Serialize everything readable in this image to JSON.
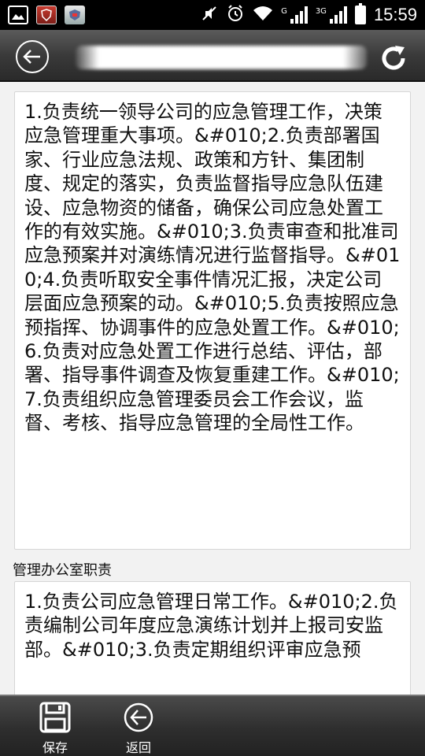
{
  "statusbar": {
    "network_g": "G",
    "network_3g": "3G",
    "time": "15:59"
  },
  "card1": {
    "text": "1.负责统一领导公司的应急管理工作，决策应急管理重大事项。&#010;2.负责部署国家、行业应急法规、政策和方针、集团制度、规定的落实，负责监督指导应急队伍建设、应急物资的储备，确保公司应急处置工作的有效实施。&#010;3.负责审查和批准司应急预案并对演练情况进行监督指导。&#010;4.负责听取安全事件情况汇报，决定公司层面应急预案的动。&#010;5.负责按照应急预指挥、协调事件的应急处置工作。&#010;6.负责对应急处置工作进行总结、评估，部署、指导事件调查及恢复重建工作。&#010;7.负责组织应急管理委员会工作会议，监督、考核、指导应急管理的全局性工作。"
  },
  "section2": {
    "label": "管理办公室职责"
  },
  "card2": {
    "text": "1.负责公司应急管理日常工作。&#010;2.负责编制公司年度应急演练计划并上报司安监部。&#010;3.负责定期组织评审应急预"
  },
  "bottombar": {
    "save_label": "保存",
    "back_label": "返回"
  }
}
